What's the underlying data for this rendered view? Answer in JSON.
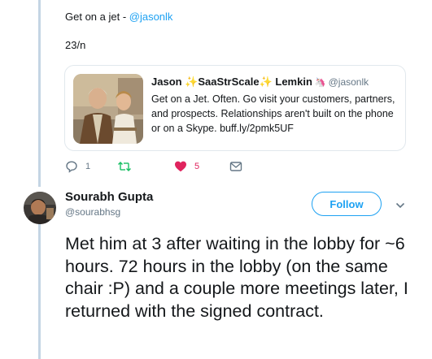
{
  "top_tweet": {
    "text": "Get on a jet - ",
    "mention": "@jasonlk",
    "counter": "23/n"
  },
  "quoted": {
    "name_first": "Jason",
    "badge_left": "✨",
    "name_mid": "SaaStrScale",
    "badge_right": "✨",
    "name_last": "Lemkin",
    "unicorn": "🦄",
    "handle": "@jasonlk",
    "body": "Get on a Jet. Often. Go visit your customers, partners, and prospects. Relationships aren't built on the phone or on a Skype. buff.ly/2pmk5UF"
  },
  "actions": {
    "replies": "1",
    "retweets": "",
    "likes": "5",
    "icons": [
      "reply-icon",
      "retweet-icon",
      "heart-icon",
      "envelope-icon"
    ]
  },
  "reply_tweet": {
    "name": "Sourabh Gupta",
    "handle": "@sourabhsg",
    "follow_label": "Follow",
    "text": "Met him at 3 after waiting in the lobby for ~6 hours. 72 hours in the lobby (on the same chair :P) and a couple more meetings later, I returned with the signed contract."
  },
  "colors": {
    "accent": "#1da1f2",
    "like": "#e0245e",
    "retweet": "#17bf63",
    "muted": "#657786",
    "thread_line": "#c4d5e4"
  }
}
